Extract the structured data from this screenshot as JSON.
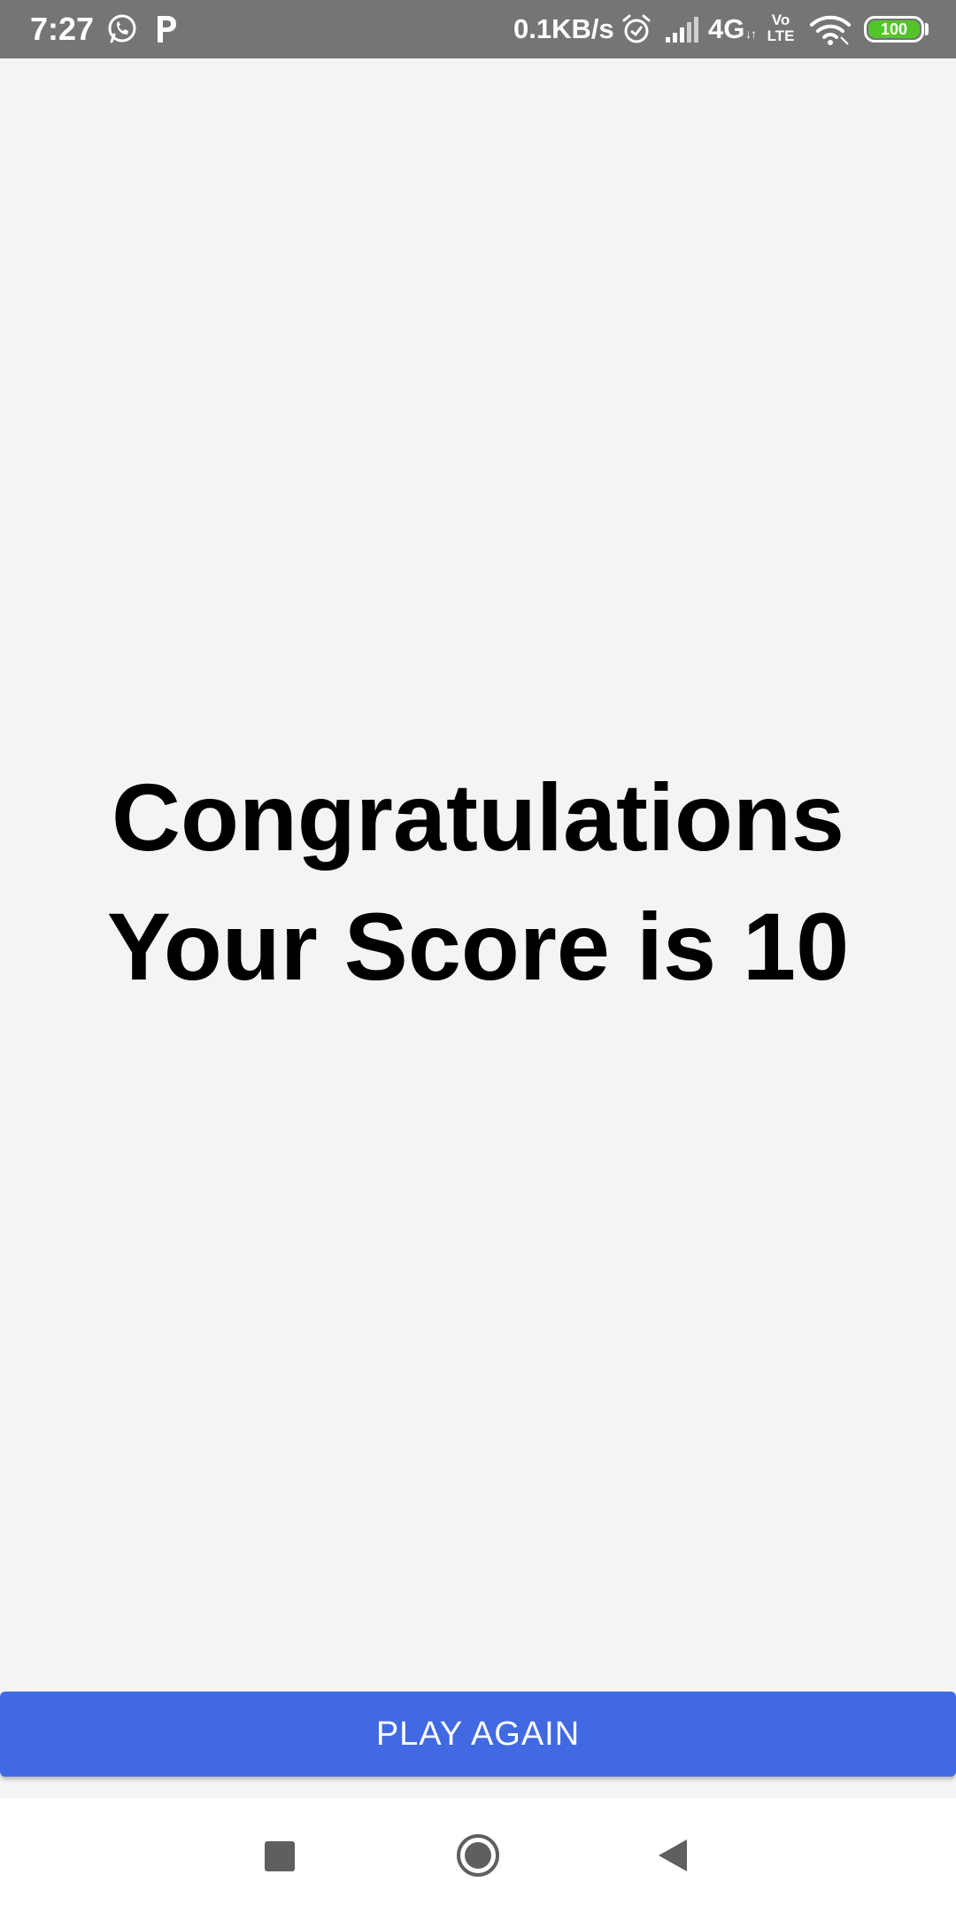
{
  "status_bar": {
    "time": "7:27",
    "network_speed": "0.1KB/s",
    "network_type": "4G",
    "data_arrows": "↓↑",
    "volte_line1": "Vo",
    "volte_line2": "LTE",
    "battery_level": "100",
    "icons": [
      "whatsapp-icon",
      "paytm-p-icon",
      "alarm-icon",
      "signal-icon",
      "wifi-icon",
      "battery-icon"
    ]
  },
  "result": {
    "line1": "Congratulations",
    "line2": "Your Score is 10"
  },
  "actions": {
    "play_again_label": "PLAY AGAIN"
  },
  "nav_bar": {
    "icons": [
      "recents-square-icon",
      "home-circle-icon",
      "back-triangle-icon"
    ]
  },
  "colors": {
    "status_bar_bg": "#757575",
    "background": "#f4f4f4",
    "button_bg": "#4169e1",
    "button_text": "#ffffff",
    "battery_fill": "#53c52a",
    "nav_icon": "#5f5f5f"
  }
}
